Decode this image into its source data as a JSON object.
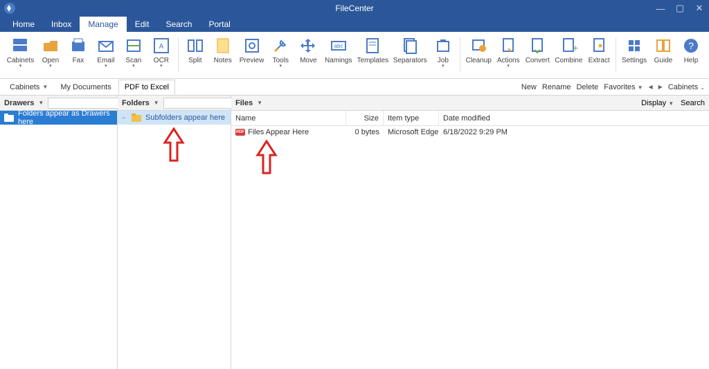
{
  "app": {
    "title": "FileCenter"
  },
  "window_ctrls": {
    "min": "—",
    "max": "▢",
    "close": "✕"
  },
  "menu": {
    "tabs": [
      "Home",
      "Inbox",
      "Manage",
      "Edit",
      "Search",
      "Portal"
    ],
    "active": "Manage"
  },
  "ribbon": [
    {
      "label": "Cabinets",
      "drop": true,
      "icon": "cabinets-icon"
    },
    {
      "label": "Open",
      "drop": true,
      "icon": "open-icon"
    },
    {
      "label": "Fax",
      "icon": "fax-icon"
    },
    {
      "label": "Email",
      "drop": true,
      "icon": "email-icon"
    },
    {
      "label": "Scan",
      "drop": true,
      "icon": "scan-icon"
    },
    {
      "label": "OCR",
      "drop": true,
      "icon": "ocr-icon"
    },
    {
      "sep": true
    },
    {
      "label": "Split",
      "icon": "split-icon"
    },
    {
      "label": "Notes",
      "icon": "notes-icon"
    },
    {
      "label": "Preview",
      "icon": "preview-icon"
    },
    {
      "label": "Tools",
      "drop": true,
      "icon": "tools-icon"
    },
    {
      "label": "Move",
      "icon": "move-icon"
    },
    {
      "label": "Namings",
      "icon": "namings-icon"
    },
    {
      "label": "Templates",
      "icon": "templates-icon"
    },
    {
      "label": "Separators",
      "icon": "separators-icon"
    },
    {
      "label": "Job",
      "drop": true,
      "icon": "job-icon"
    },
    {
      "sep": true
    },
    {
      "label": "Cleanup",
      "icon": "cleanup-icon"
    },
    {
      "label": "Actions",
      "drop": true,
      "icon": "actions-icon"
    },
    {
      "label": "Convert",
      "icon": "convert-icon"
    },
    {
      "label": "Combine",
      "icon": "combine-icon"
    },
    {
      "label": "Extract",
      "icon": "extract-icon"
    },
    {
      "sep": true
    },
    {
      "label": "Settings",
      "icon": "settings-icon"
    },
    {
      "label": "Guide",
      "icon": "guide-icon"
    },
    {
      "label": "Help",
      "icon": "help-icon"
    }
  ],
  "secbar": {
    "left": {
      "cabinets": "Cabinets",
      "crumb1": "My Documents",
      "tab_active": "PDF to Excel"
    },
    "right": {
      "new": "New",
      "rename": "Rename",
      "delete": "Delete",
      "favorites": "Favorites",
      "cabinets2": "Cabinets"
    }
  },
  "panels": {
    "drawers": {
      "title": "Drawers",
      "row": "Folders appear as Drawers here"
    },
    "folders": {
      "title": "Folders",
      "row": "Subfolders appear here"
    },
    "files": {
      "title": "Files",
      "display": "Display",
      "search": "Search",
      "cols": {
        "name": "Name",
        "size": "Size",
        "type": "Item type",
        "date": "Date modified"
      },
      "rows": [
        {
          "name": "Files Appear Here",
          "size": "0 bytes",
          "type": "Microsoft Edge PD...",
          "date": "6/18/2022 9:29 PM"
        }
      ]
    }
  }
}
